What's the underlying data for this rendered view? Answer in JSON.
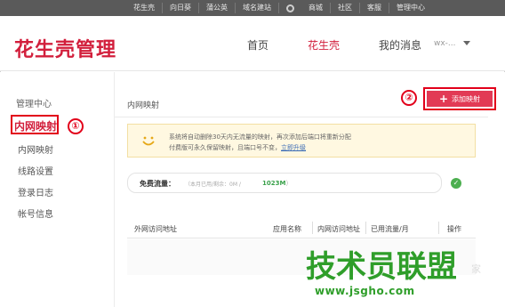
{
  "topbar": {
    "links": [
      "花生壳",
      "向日葵",
      "蒲公英",
      "域名建站",
      "商城",
      "社区",
      "客服",
      "管理中心"
    ]
  },
  "header": {
    "logo": "花生壳管理",
    "nav": [
      {
        "label": "首页",
        "active": false
      },
      {
        "label": "花生壳",
        "active": true
      },
      {
        "label": "我的消息",
        "active": false
      }
    ],
    "user": "wx-..."
  },
  "sidebar": {
    "title": "管理中心",
    "highlighted_item": "内网映射",
    "items": [
      "内网映射",
      "线路设置",
      "登录日志",
      "帐号信息"
    ],
    "annotation_1": "①"
  },
  "main": {
    "title": "内网映射",
    "add_button": "添加映射",
    "annotation_2": "②",
    "notice": {
      "line1": "系统将自动删除30天内无流量的映射，再次添加后端口将重新分配",
      "line2": "付费版可永久保留映射，且端口号不变，",
      "upgrade_link": "立即升级"
    },
    "flow": {
      "label": "免费流量：",
      "detail": "（本月已用/剩余：0M /",
      "quota": "1023M",
      "detail_end": "）"
    },
    "table_headers": [
      "外网访问地址",
      "应用名称",
      "内网访问地址",
      "已用流量/月",
      "操作"
    ]
  },
  "watermark": {
    "big": "技术员联盟",
    "small": "www.jsgho.com",
    "corner": "家"
  },
  "colors": {
    "brand_red": "#d21f3c",
    "annotation_red": "#e2001a",
    "watermark_green": "#2f9e2a"
  }
}
